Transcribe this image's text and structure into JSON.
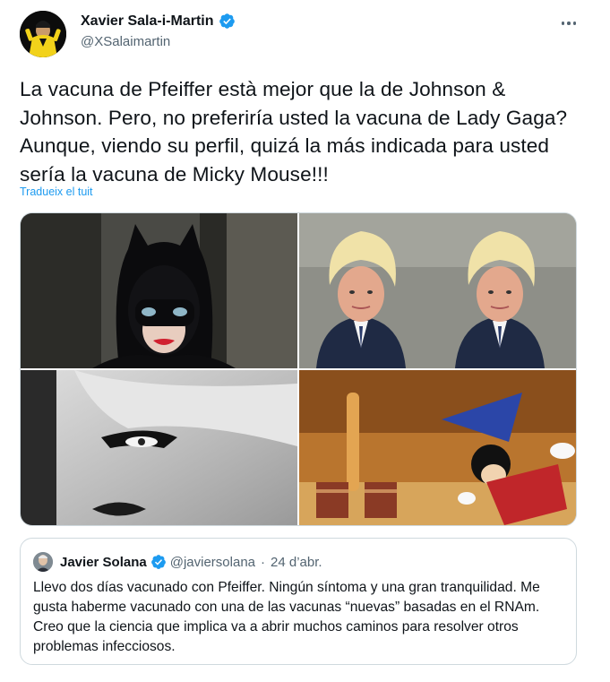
{
  "tweet": {
    "author_name": "Xavier Sala-i-Martin",
    "author_handle": "@XSalaimartin",
    "text": "La vacuna de Pfeiffer està mejor que la de Johnson & Johnson. Pero, no preferiría usted la vacuna de Lady Gaga? Aunque, viendo su perfil, quizá la más indicada para usted sería la vacuna de Micky Mouse!!!",
    "translate_label": "Tradueix el tuit",
    "media_alt": [
      "Catwoman",
      "Boris Johnson",
      "Boris Johnson",
      "Lady Gaga",
      "Mickey Mouse"
    ]
  },
  "quote": {
    "author_name": "Javier Solana",
    "author_handle": "@javiersolana",
    "separator": "·",
    "date": "24 d’abr.",
    "text": "Llevo dos días vacunado con Pfeiffer. Ningún síntoma y una gran tranquilidad. Me gusta haberme vacunado con una de las vacunas “nuevas” basadas en el RNAm. Creo que la ciencia que implica va a abrir muchos caminos para resolver otros problemas infecciosos."
  },
  "colors": {
    "verified": "#1d9bf0",
    "link": "#1d9bf0",
    "secondary_text": "#536471",
    "border": "#cfd9de"
  },
  "icons": [
    "verified-badge-icon",
    "more-options-icon"
  ]
}
